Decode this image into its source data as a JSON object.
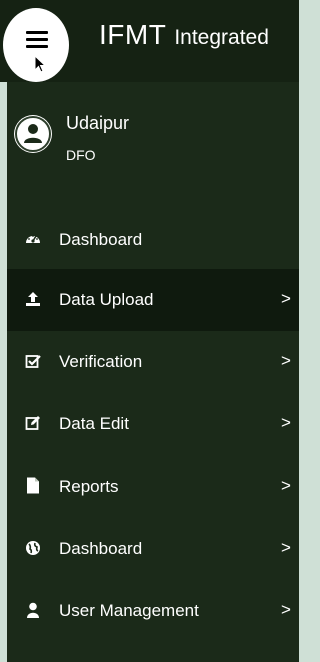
{
  "header": {
    "title": "IFMT",
    "subtitle": "Integrated"
  },
  "user": {
    "name": "Udaipur",
    "role": "DFO"
  },
  "nav": {
    "items": [
      {
        "label": "Dashboard",
        "icon": "dashboard-gauge-icon",
        "arrow": ""
      },
      {
        "label": "Data Upload",
        "icon": "upload-icon",
        "arrow": ">"
      },
      {
        "label": "Verification",
        "icon": "checkbox-icon",
        "arrow": ">"
      },
      {
        "label": "Data Edit",
        "icon": "edit-icon",
        "arrow": ">"
      },
      {
        "label": "Reports",
        "icon": "document-icon",
        "arrow": ">"
      },
      {
        "label": "Dashboard",
        "icon": "globe-icon",
        "arrow": ">"
      },
      {
        "label": "User Management",
        "icon": "user-icon",
        "arrow": ">"
      }
    ]
  },
  "colors": {
    "header_bg": "#152213",
    "sidebar_bg": "#1b2a19",
    "active_bg": "#0f1a0e",
    "page_bg": "#cfe0d6"
  }
}
